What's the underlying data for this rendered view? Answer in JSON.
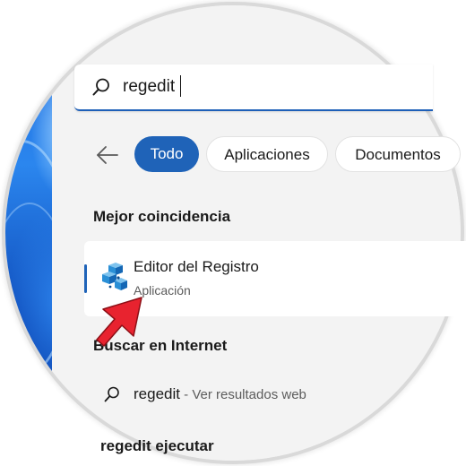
{
  "search": {
    "value": "regedit"
  },
  "filters": {
    "back_icon": "arrow-left-icon",
    "tabs": [
      {
        "label": "Todo",
        "active": true
      },
      {
        "label": "Aplicaciones",
        "active": false
      },
      {
        "label": "Documentos",
        "active": false
      }
    ]
  },
  "best_match": {
    "heading": "Mejor coincidencia",
    "name": "Editor del Registro",
    "type": "Aplicación",
    "icon": "registry-editor-icon"
  },
  "internet": {
    "heading": "Buscar en Internet",
    "query": "regedit",
    "hint": " - Ver resultados web"
  },
  "suggestion": {
    "label": "regedit ejecutar"
  },
  "colors": {
    "accent": "#1f63b8",
    "panel_bg": "#f3f3f3",
    "annotation_arrow": "#e8232f"
  }
}
